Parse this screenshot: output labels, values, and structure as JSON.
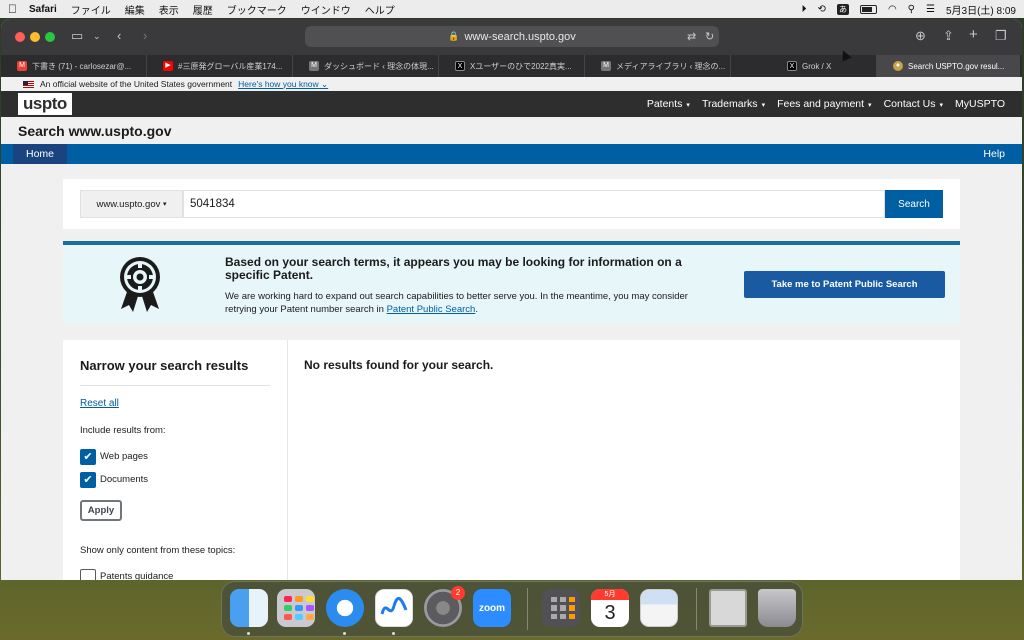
{
  "menubar": {
    "apple_icon": "apple-icon",
    "items": [
      "Safari",
      "ファイル",
      "編集",
      "表示",
      "履歴",
      "ブックマーク",
      "ウインドウ",
      "ヘルプ"
    ],
    "input_method": "あ",
    "clock": "5月3日(土)  8:09"
  },
  "browser": {
    "url": "www-search.uspto.gov",
    "tabs": [
      {
        "label": "下書き (71) - carlosezar@...",
        "fav": "M",
        "color": "#ea4335"
      },
      {
        "label": "#三原発グローバル産業174...",
        "fav": "▶",
        "color": "#ff0000"
      },
      {
        "label": "ダッシュボード ‹ 理念の体現...",
        "fav": "M",
        "color": "#777777"
      },
      {
        "label": "Xユーザーのひで2022真実...",
        "fav": "X",
        "color": "#000000"
      },
      {
        "label": "メディアライブラリ ‹ 理念の...",
        "fav": "M",
        "color": "#777777"
      },
      {
        "label": "Grok / X",
        "fav": "X",
        "color": "#000000"
      },
      {
        "label": "Search USPTO.gov resul...",
        "fav": "●",
        "color": "#c8a24a"
      }
    ]
  },
  "gov_banner": {
    "text": "An official website of the United States government",
    "link": "Here's how you know"
  },
  "header": {
    "logo": "uspto",
    "nav": [
      {
        "label": "Patents",
        "caret": "▾"
      },
      {
        "label": "Trademarks",
        "caret": "▾"
      },
      {
        "label": "Fees and payment",
        "caret": "▾"
      },
      {
        "label": "Contact Us",
        "caret": "▾"
      },
      {
        "label": "MyUSPTO",
        "caret": ""
      }
    ]
  },
  "page": {
    "title": "Search www.uspto.gov",
    "home": "Home",
    "help": "Help"
  },
  "search": {
    "scope": "www.uspto.gov",
    "query": "5041834",
    "button": "Search"
  },
  "alert": {
    "heading": "Based on your search terms, it appears you may be looking for information on a specific Patent.",
    "body": "We are working hard to expand out search capabilities to better serve you. In the meantime, you may consider retrying your Patent number search in",
    "link": "Patent Public Search",
    "end": ".",
    "button": "Take me to Patent Public Search"
  },
  "filters": {
    "title": "Narrow your search results",
    "reset": "Reset all",
    "include_label": "Include results from:",
    "options": [
      {
        "label": "Web pages",
        "checked": true
      },
      {
        "label": "Documents",
        "checked": true
      }
    ],
    "apply": "Apply",
    "topics_label": "Show only content from these topics:",
    "topic_first": "Patents guidance"
  },
  "results": {
    "message": "No results found for your search."
  },
  "dock": {
    "items": [
      "finder-icon",
      "launchpad-icon",
      "safari-icon",
      "freeform-icon",
      "system-settings-icon",
      "zoom-icon",
      "calculator-icon",
      "calendar-icon",
      "preview-icon",
      "documents-stack-icon",
      "trash-icon"
    ],
    "settings_badge": "2",
    "zoom_label": "zoom",
    "calendar_month": "5月",
    "calendar_day": "3"
  }
}
